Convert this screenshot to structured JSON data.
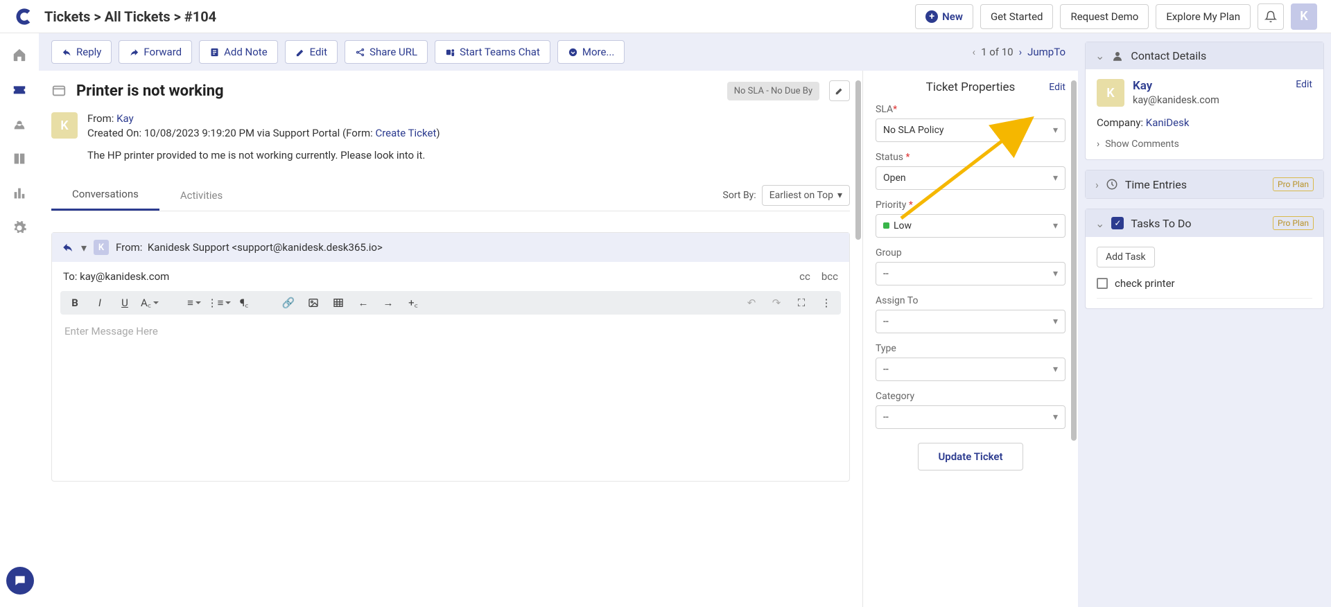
{
  "breadcrumb": "Tickets > All Tickets > #104",
  "topbar": {
    "new_label": "New",
    "get_started": "Get Started",
    "request_demo": "Request Demo",
    "explore_plan": "Explore My Plan",
    "avatar_initial": "K"
  },
  "actions": {
    "reply": "Reply",
    "forward": "Forward",
    "add_note": "Add Note",
    "edit": "Edit",
    "share_url": "Share URL",
    "start_teams": "Start Teams Chat",
    "more": "More..."
  },
  "pager": {
    "text": "1 of 10",
    "jump": "JumpTo"
  },
  "ticket": {
    "title": "Printer is not working",
    "nosla": "No SLA - No Due By",
    "avatar_initial": "K",
    "from_label": "From:",
    "from_name": "Kay",
    "created_prefix": "Created On: ",
    "created_on": "10/08/2023 9:19:20 PM via Support Portal (Form: ",
    "form_link": "Create Ticket",
    "created_suffix": ")",
    "description": "The HP printer provided to me is not working currently. Please look into it."
  },
  "tabs": {
    "conversations": "Conversations",
    "activities": "Activities"
  },
  "sort": {
    "label": "Sort By:",
    "value": "Earliest on Top"
  },
  "reply_panel": {
    "mini_initial": "K",
    "from_label": "From:",
    "from_value": "Kanidesk Support <support@kanidesk.desk365.io>",
    "to_label": "To:",
    "to_value": "kay@kanidesk.com",
    "cc": "cc",
    "bcc": "bcc",
    "placeholder": "Enter Message Here"
  },
  "properties": {
    "heading": "Ticket Properties",
    "edit": "Edit",
    "fields": {
      "sla": {
        "label": "SLA",
        "required": true,
        "value": "No SLA Policy"
      },
      "status": {
        "label": "Status",
        "required": true,
        "value": "Open"
      },
      "priority": {
        "label": "Priority",
        "required": true,
        "value": "Low"
      },
      "group": {
        "label": "Group",
        "required": false,
        "value": "--"
      },
      "assign_to": {
        "label": "Assign To",
        "required": false,
        "value": "--"
      },
      "type": {
        "label": "Type",
        "required": false,
        "value": "--"
      },
      "category": {
        "label": "Category",
        "required": false,
        "value": "--"
      }
    },
    "update_btn": "Update Ticket"
  },
  "contact": {
    "heading": "Contact Details",
    "avatar_initial": "K",
    "name": "Kay",
    "email": "kay@kanidesk.com",
    "edit": "Edit",
    "company_label": "Company: ",
    "company": "KaniDesk",
    "show_comments": "Show Comments"
  },
  "time_entries": {
    "heading": "Time Entries",
    "badge": "Pro Plan"
  },
  "tasks": {
    "heading": "Tasks To Do",
    "badge": "Pro Plan",
    "add_task": "Add Task",
    "items": [
      {
        "label": "check printer",
        "done": false
      }
    ]
  }
}
